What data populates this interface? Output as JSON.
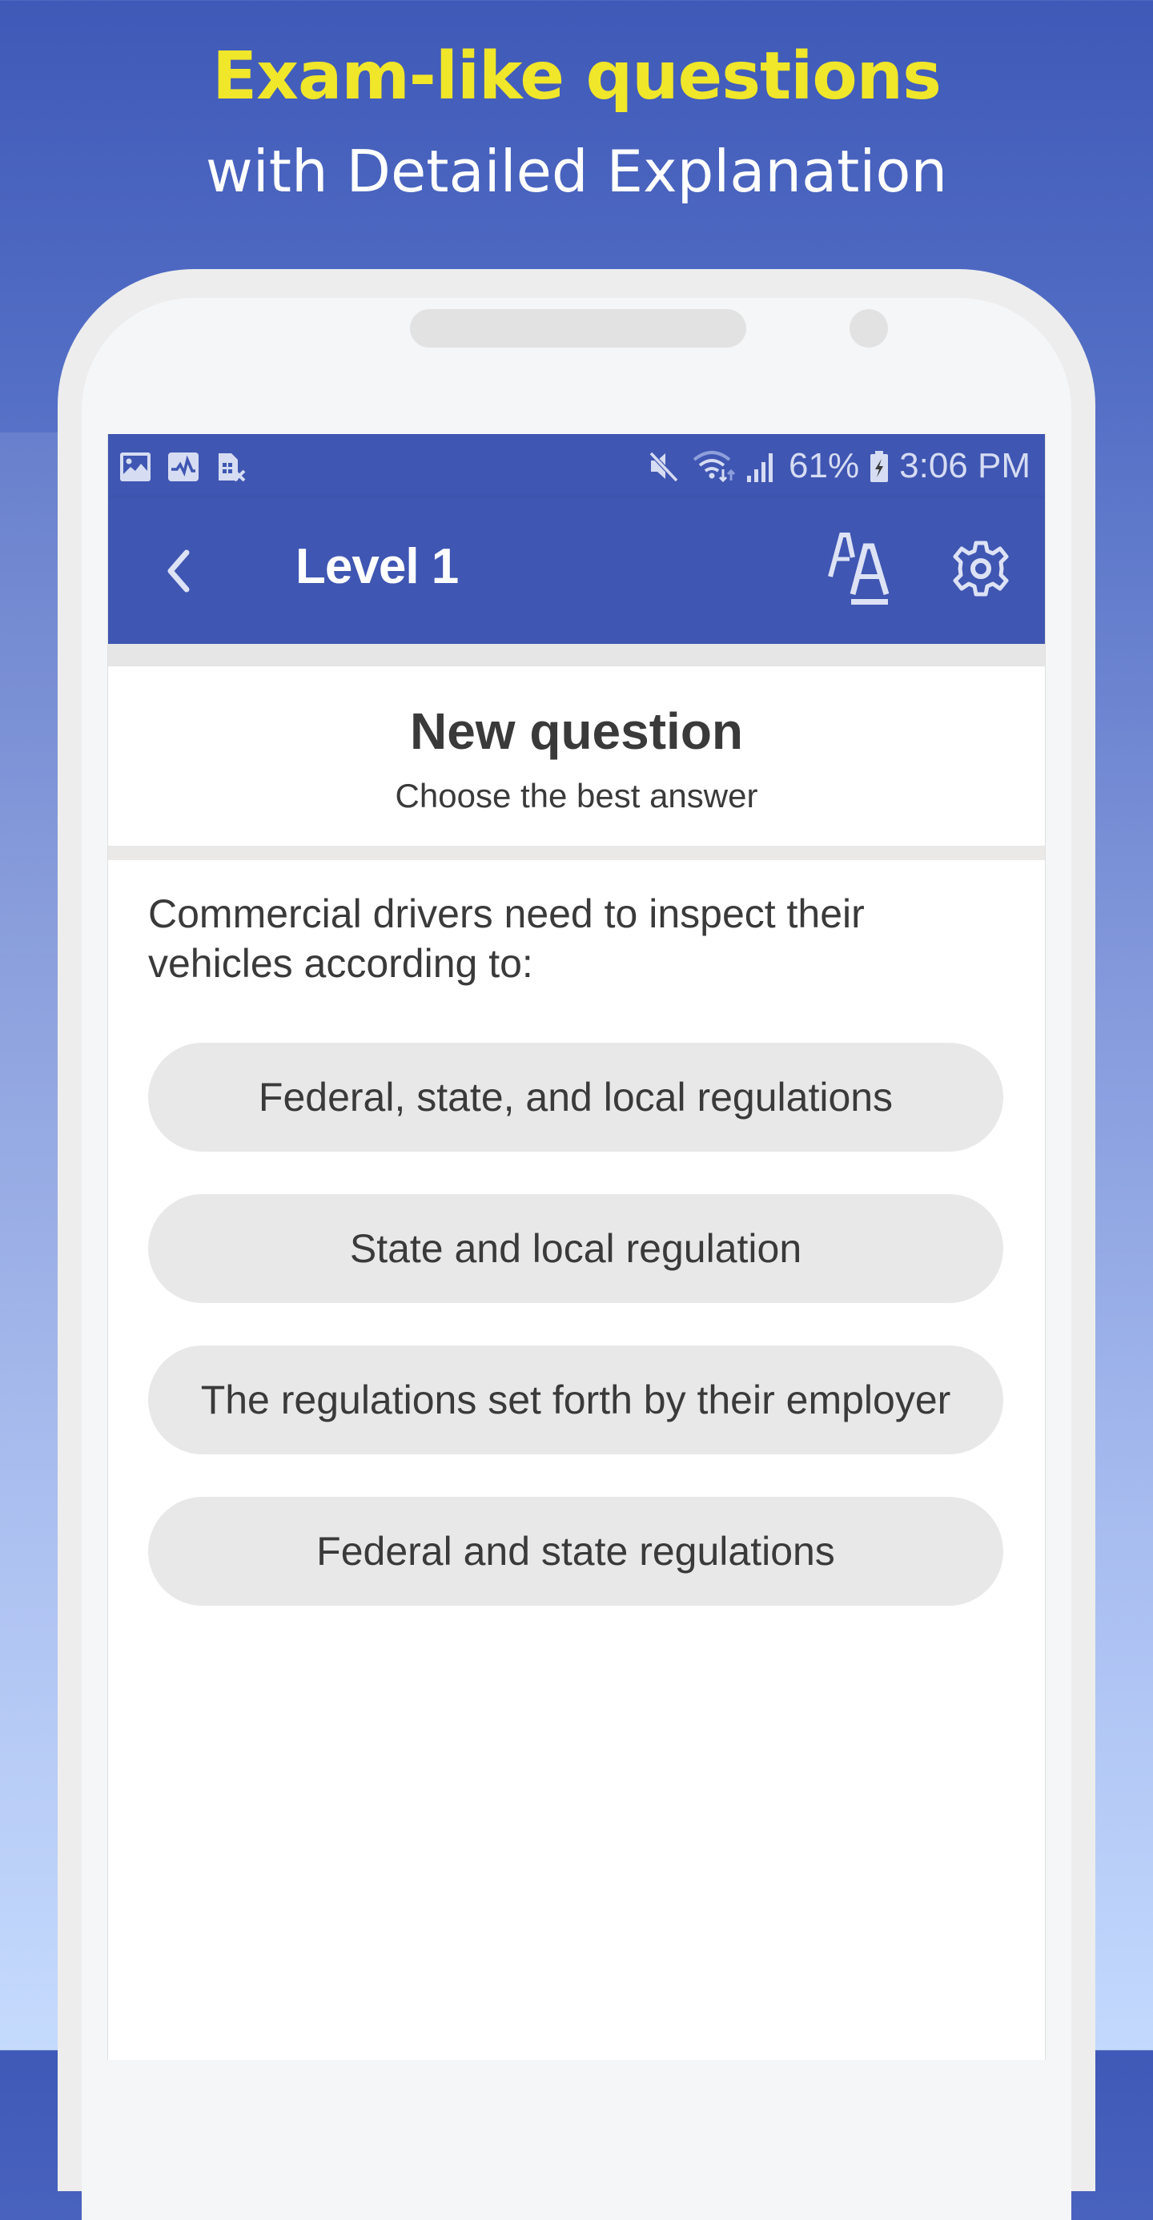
{
  "promo": {
    "headline": "Exam-like questions",
    "subheadline": "with Detailed Explanation",
    "headline_color": "#f0e62a"
  },
  "statusbar": {
    "left_icons": [
      "gallery-icon",
      "activity-icon",
      "no-sim-icon"
    ],
    "right_icons": [
      "mute-icon",
      "wifi-icon",
      "signal-icon"
    ],
    "battery_percent": "61%",
    "battery_icon": "battery-charging-icon",
    "time": "3:06 PM"
  },
  "toolbar": {
    "back_icon": "chevron-left-icon",
    "title": "Level 1",
    "text_size_icon": "text-size-icon",
    "settings_icon": "gear-icon",
    "color": "#3f56b2"
  },
  "header_card": {
    "title": "New question",
    "subtitle": "Choose the best answer"
  },
  "question": {
    "text": "Commercial drivers need to inspect their vehicles according to:"
  },
  "answers": [
    {
      "label": "Federal, state, and local regulations"
    },
    {
      "label": "State and local regulation"
    },
    {
      "label": "The regulations set forth by their employer"
    },
    {
      "label": "Federal and state regulations"
    }
  ]
}
